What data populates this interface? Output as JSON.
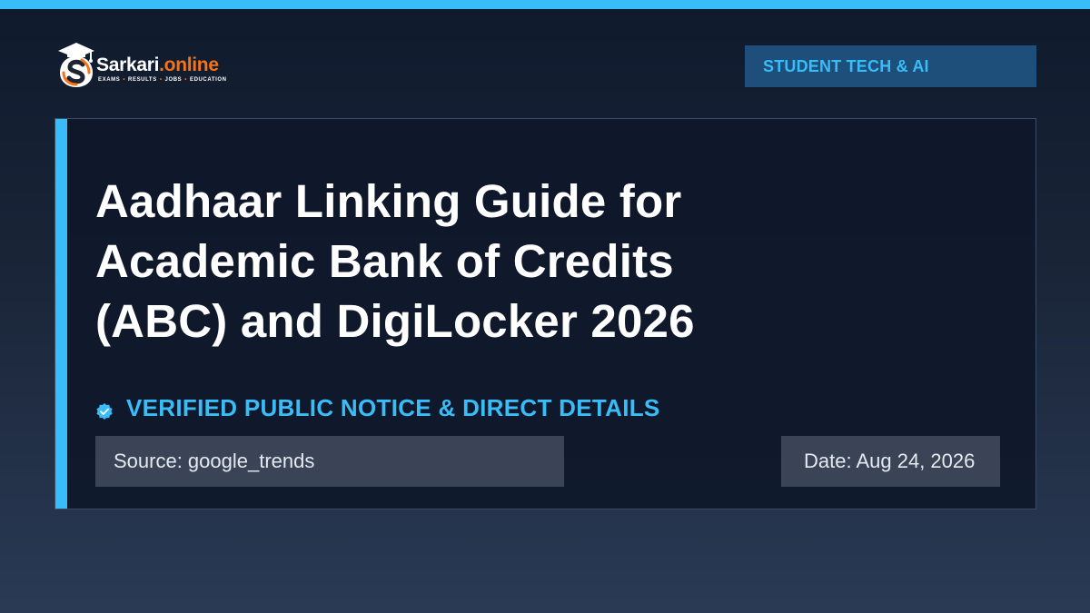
{
  "brand": {
    "name": "Sarkari",
    "dot": ".",
    "tld": "online",
    "tagline": [
      "EXAMS",
      "RESULTS",
      "JOBS",
      "EDUCATION"
    ],
    "tagline_separator": "•",
    "colors": {
      "accent": "#f97316",
      "primary": "#ffffff"
    }
  },
  "category": {
    "label": "STUDENT TECH & AI"
  },
  "article": {
    "title": "Aadhaar Linking Guide for Academic Bank of Credits (ABC) and DigiLocker 2026",
    "verified_label": "VERIFIED PUBLIC NOTICE & DIRECT DETAILS",
    "source": "Source: google_trends",
    "date": "Date: Aug 24, 2026"
  },
  "icons": {
    "logo": "graduation-cap-s-logo-icon",
    "verified": "verified-check-icon"
  },
  "theme": {
    "accent": "#38bdf8",
    "badge_bg": "#1e4f7a",
    "card_bg": "#0f182a",
    "meta_bg": "#3a4456",
    "text": "#ffffff"
  }
}
